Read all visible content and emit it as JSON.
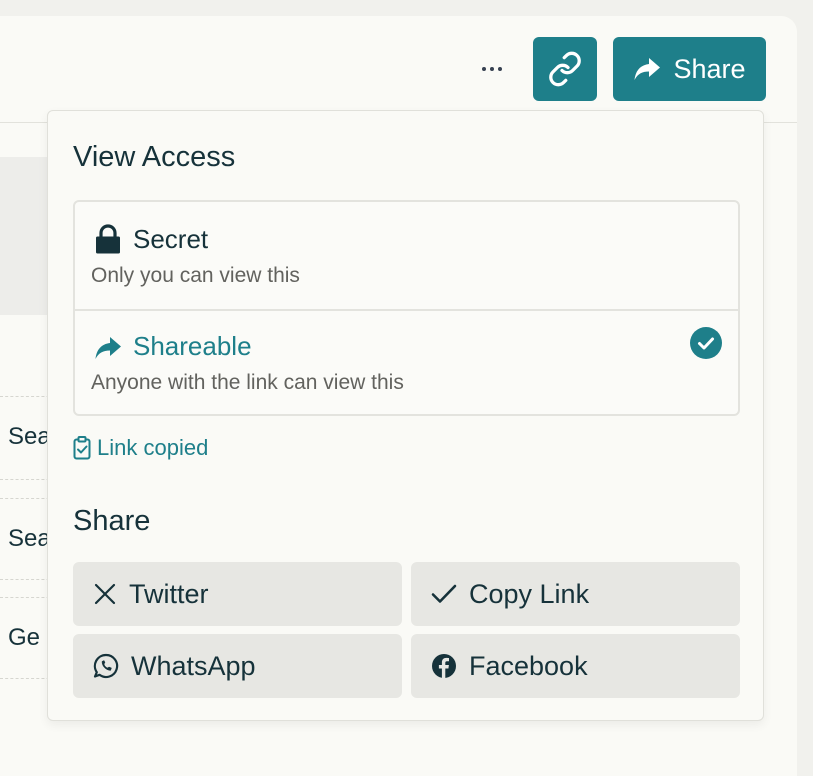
{
  "header": {
    "share_label": "Share",
    "more_icon": "more-horizontal-icon",
    "link_icon": "link-icon",
    "share_icon": "share-arrow-icon"
  },
  "background_rows": [
    "Sea",
    "Sea",
    "Ge"
  ],
  "view_access": {
    "title": "View Access",
    "options": [
      {
        "label": "Secret",
        "description": "Only you can view this",
        "icon": "lock-icon",
        "selected": false
      },
      {
        "label": "Shareable",
        "description": "Anyone with the link can view this",
        "icon": "share-arrow-icon",
        "selected": true
      }
    ],
    "link_copied": "Link copied"
  },
  "share": {
    "title": "Share",
    "buttons": [
      {
        "label": "Twitter",
        "icon": "x-twitter-icon"
      },
      {
        "label": "Copy Link",
        "icon": "checkmark-icon"
      },
      {
        "label": "WhatsApp",
        "icon": "whatsapp-icon"
      },
      {
        "label": "Facebook",
        "icon": "facebook-icon"
      }
    ]
  },
  "colors": {
    "accent": "#1e7f8a",
    "text": "#16323a",
    "muted": "#62625e",
    "button_bg": "#e7e7e3"
  }
}
